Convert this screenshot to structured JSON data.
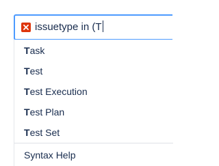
{
  "query": {
    "text": "issuetype in (T",
    "status_icon": "error-icon",
    "status_color": "#de350b"
  },
  "suggestions": [
    {
      "match": "T",
      "rest": "ask"
    },
    {
      "match": "T",
      "rest": "est"
    },
    {
      "match": "T",
      "rest": "est Execution"
    },
    {
      "match": "T",
      "rest": "est Plan"
    },
    {
      "match": "T",
      "rest": "est Set"
    }
  ],
  "footer": {
    "syntax_help_label": "Syntax Help"
  },
  "colors": {
    "focus_border": "#4c9aff",
    "text": "#172b4d"
  }
}
